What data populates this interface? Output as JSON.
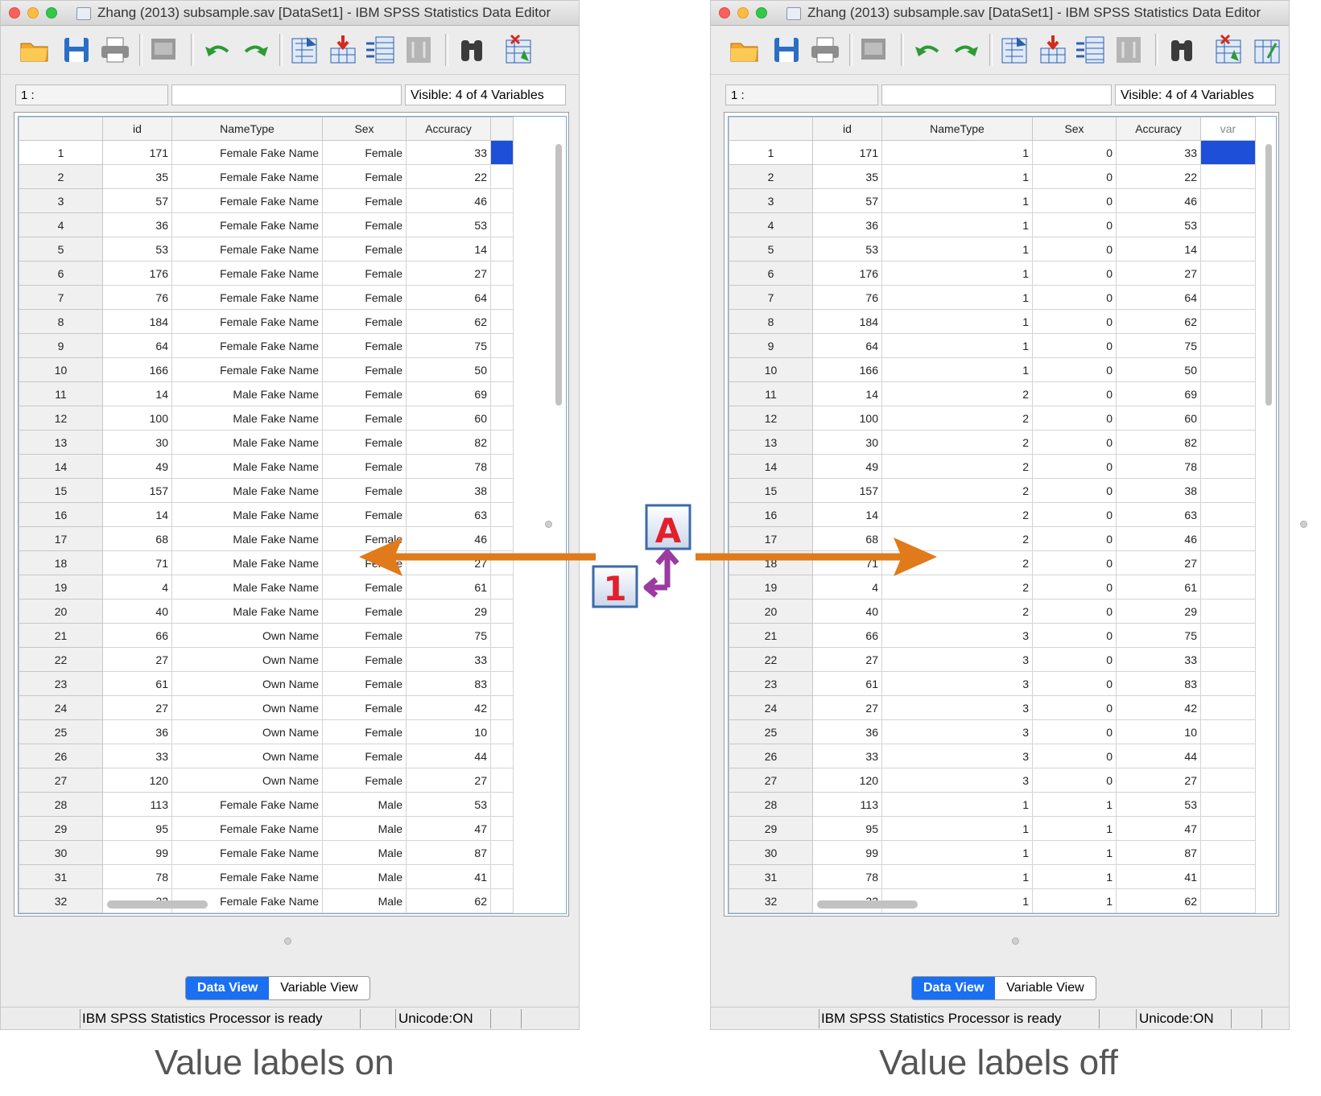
{
  "left_window": {
    "title": "Zhang (2013) subsample.sav [DataSet1] - IBM SPSS Statistics Data Editor",
    "cell_ref": "1 :",
    "visible": "Visible: 4 of 4 Variables",
    "columns": [
      "id",
      "NameType",
      "Sex",
      "Accuracy",
      ""
    ],
    "rows": [
      [
        "1",
        "171",
        "Female Fake Name",
        "Female",
        "33"
      ],
      [
        "2",
        "35",
        "Female Fake Name",
        "Female",
        "22"
      ],
      [
        "3",
        "57",
        "Female Fake Name",
        "Female",
        "46"
      ],
      [
        "4",
        "36",
        "Female Fake Name",
        "Female",
        "53"
      ],
      [
        "5",
        "53",
        "Female Fake Name",
        "Female",
        "14"
      ],
      [
        "6",
        "176",
        "Female Fake Name",
        "Female",
        "27"
      ],
      [
        "7",
        "76",
        "Female Fake Name",
        "Female",
        "64"
      ],
      [
        "8",
        "184",
        "Female Fake Name",
        "Female",
        "62"
      ],
      [
        "9",
        "64",
        "Female Fake Name",
        "Female",
        "75"
      ],
      [
        "10",
        "166",
        "Female Fake Name",
        "Female",
        "50"
      ],
      [
        "11",
        "14",
        "Male Fake Name",
        "Female",
        "69"
      ],
      [
        "12",
        "100",
        "Male Fake Name",
        "Female",
        "60"
      ],
      [
        "13",
        "30",
        "Male Fake Name",
        "Female",
        "82"
      ],
      [
        "14",
        "49",
        "Male Fake Name",
        "Female",
        "78"
      ],
      [
        "15",
        "157",
        "Male Fake Name",
        "Female",
        "38"
      ],
      [
        "16",
        "14",
        "Male Fake Name",
        "Female",
        "63"
      ],
      [
        "17",
        "68",
        "Male Fake Name",
        "Female",
        "46"
      ],
      [
        "18",
        "71",
        "Male Fake Name",
        "Female",
        "27"
      ],
      [
        "19",
        "4",
        "Male Fake Name",
        "Female",
        "61"
      ],
      [
        "20",
        "40",
        "Male Fake Name",
        "Female",
        "29"
      ],
      [
        "21",
        "66",
        "Own Name",
        "Female",
        "75"
      ],
      [
        "22",
        "27",
        "Own Name",
        "Female",
        "33"
      ],
      [
        "23",
        "61",
        "Own Name",
        "Female",
        "83"
      ],
      [
        "24",
        "27",
        "Own Name",
        "Female",
        "42"
      ],
      [
        "25",
        "36",
        "Own Name",
        "Female",
        "10"
      ],
      [
        "26",
        "33",
        "Own Name",
        "Female",
        "44"
      ],
      [
        "27",
        "120",
        "Own Name",
        "Female",
        "27"
      ],
      [
        "28",
        "113",
        "Female Fake Name",
        "Male",
        "53"
      ],
      [
        "29",
        "95",
        "Female Fake Name",
        "Male",
        "47"
      ],
      [
        "30",
        "99",
        "Female Fake Name",
        "Male",
        "87"
      ],
      [
        "31",
        "78",
        "Female Fake Name",
        "Male",
        "41"
      ],
      [
        "32",
        "32",
        "Female Fake Name",
        "Male",
        "62"
      ]
    ],
    "tab_data": "Data View",
    "tab_variable": "Variable View",
    "status": "IBM SPSS Statistics Processor is ready",
    "unicode": "Unicode:ON"
  },
  "right_window": {
    "title": "Zhang (2013) subsample.sav [DataSet1] - IBM SPSS Statistics Data Editor",
    "cell_ref": "1 :",
    "visible": "Visible: 4 of 4 Variables",
    "columns": [
      "id",
      "NameType",
      "Sex",
      "Accuracy",
      "var"
    ],
    "rows": [
      [
        "1",
        "171",
        "1",
        "0",
        "33"
      ],
      [
        "2",
        "35",
        "1",
        "0",
        "22"
      ],
      [
        "3",
        "57",
        "1",
        "0",
        "46"
      ],
      [
        "4",
        "36",
        "1",
        "0",
        "53"
      ],
      [
        "5",
        "53",
        "1",
        "0",
        "14"
      ],
      [
        "6",
        "176",
        "1",
        "0",
        "27"
      ],
      [
        "7",
        "76",
        "1",
        "0",
        "64"
      ],
      [
        "8",
        "184",
        "1",
        "0",
        "62"
      ],
      [
        "9",
        "64",
        "1",
        "0",
        "75"
      ],
      [
        "10",
        "166",
        "1",
        "0",
        "50"
      ],
      [
        "11",
        "14",
        "2",
        "0",
        "69"
      ],
      [
        "12",
        "100",
        "2",
        "0",
        "60"
      ],
      [
        "13",
        "30",
        "2",
        "0",
        "82"
      ],
      [
        "14",
        "49",
        "2",
        "0",
        "78"
      ],
      [
        "15",
        "157",
        "2",
        "0",
        "38"
      ],
      [
        "16",
        "14",
        "2",
        "0",
        "63"
      ],
      [
        "17",
        "68",
        "2",
        "0",
        "46"
      ],
      [
        "18",
        "71",
        "2",
        "0",
        "27"
      ],
      [
        "19",
        "4",
        "2",
        "0",
        "61"
      ],
      [
        "20",
        "40",
        "2",
        "0",
        "29"
      ],
      [
        "21",
        "66",
        "3",
        "0",
        "75"
      ],
      [
        "22",
        "27",
        "3",
        "0",
        "33"
      ],
      [
        "23",
        "61",
        "3",
        "0",
        "83"
      ],
      [
        "24",
        "27",
        "3",
        "0",
        "42"
      ],
      [
        "25",
        "36",
        "3",
        "0",
        "10"
      ],
      [
        "26",
        "33",
        "3",
        "0",
        "44"
      ],
      [
        "27",
        "120",
        "3",
        "0",
        "27"
      ],
      [
        "28",
        "113",
        "1",
        "1",
        "53"
      ],
      [
        "29",
        "95",
        "1",
        "1",
        "47"
      ],
      [
        "30",
        "99",
        "1",
        "1",
        "87"
      ],
      [
        "31",
        "78",
        "1",
        "1",
        "41"
      ],
      [
        "32",
        "32",
        "1",
        "1",
        "62"
      ]
    ],
    "tab_data": "Data View",
    "tab_variable": "Variable View",
    "status": "IBM SPSS Statistics Processor is ready",
    "unicode": "Unicode:ON"
  },
  "captions": {
    "left": "Value labels on",
    "right": "Value labels off"
  },
  "value_labels_icon": {
    "letter": "A",
    "number": "1"
  },
  "colors": {
    "arrow": "#e07a1a",
    "active_tab": "#1a6ff2",
    "selected_cell": "#1d4fd8"
  }
}
